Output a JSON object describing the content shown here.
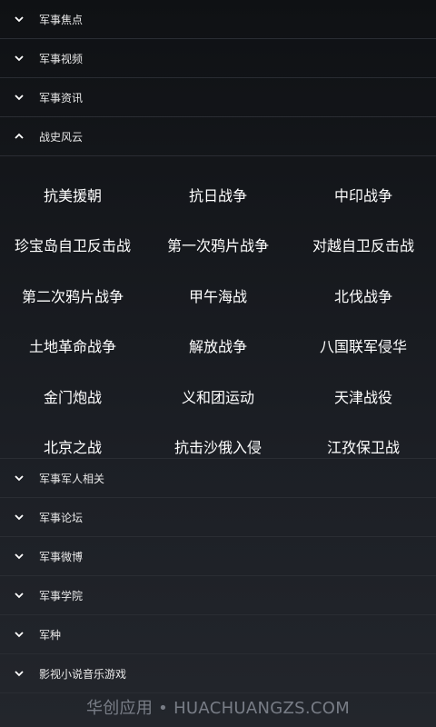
{
  "menu_top": [
    {
      "label": "军事焦点",
      "expanded": false
    },
    {
      "label": "军事视频",
      "expanded": false
    },
    {
      "label": "军事资讯",
      "expanded": false
    },
    {
      "label": "战史风云",
      "expanded": true
    }
  ],
  "expanded_grid": [
    [
      "抗美援朝",
      "抗日战争",
      "中印战争"
    ],
    [
      "珍宝岛自卫反击战",
      "第一次鸦片战争",
      "对越自卫反击战"
    ],
    [
      "第二次鸦片战争",
      "甲午海战",
      "北伐战争"
    ],
    [
      "土地革命战争",
      "解放战争",
      "八国联军侵华"
    ],
    [
      "金门炮战",
      "义和团运动",
      "天津战役"
    ],
    [
      "北京之战",
      "抗击沙俄入侵",
      "江孜保卫战"
    ]
  ],
  "menu_bottom": [
    {
      "label": "军事军人相关",
      "expanded": false
    },
    {
      "label": "军事论坛",
      "expanded": false
    },
    {
      "label": "军事微博",
      "expanded": false
    },
    {
      "label": "军事学院",
      "expanded": false
    },
    {
      "label": "军种",
      "expanded": false
    },
    {
      "label": "影视小说音乐游戏",
      "expanded": false
    }
  ],
  "watermark": "华创应用 • HUACHUANGZS.COM",
  "icons": {
    "collapsed": "chevron-down-icon",
    "expanded": "chevron-up-icon"
  },
  "colors": {
    "background": "#121418",
    "divider": "#2a2d33",
    "text": "#ffffff"
  }
}
